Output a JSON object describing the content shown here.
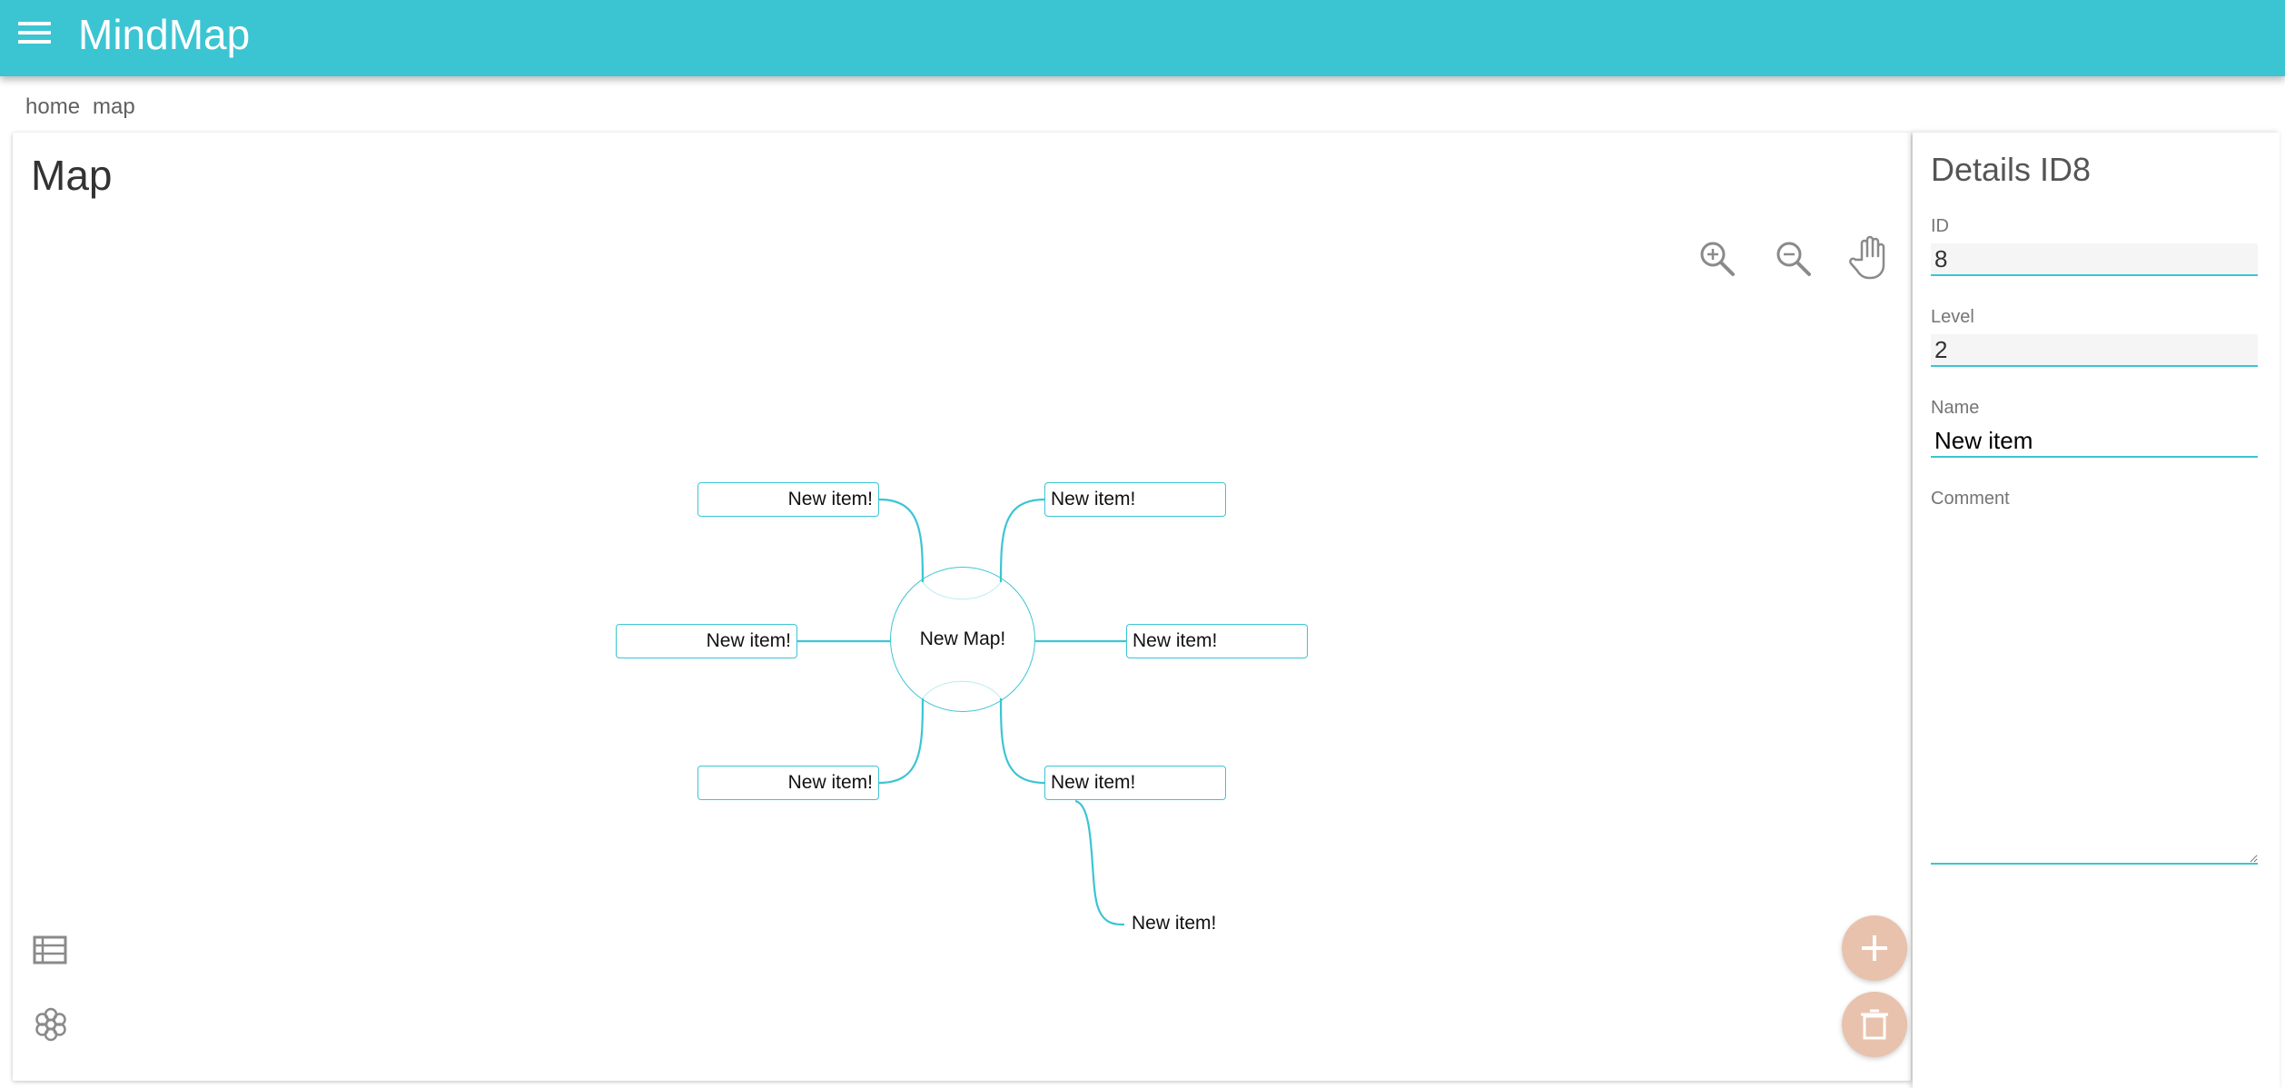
{
  "app": {
    "title": "MindMap"
  },
  "breadcrumb": [
    "home",
    "map"
  ],
  "map": {
    "title": "Map",
    "center_label": "New Map!",
    "nodes": {
      "top_left": "New item!",
      "top_right": "New item!",
      "mid_left": "New item!",
      "mid_right": "New item!",
      "bottom_left": "New item!",
      "bottom_right": "New item!",
      "child": "New item!"
    },
    "controls": [
      "zoom-in-icon",
      "zoom-out-icon",
      "pan-hand-icon"
    ]
  },
  "sidebar_icons": [
    "list-icon",
    "flower-icon"
  ],
  "fab": [
    "add-icon",
    "delete-icon"
  ],
  "details": {
    "title": "Details ID8",
    "id_label": "ID",
    "id_value": "8",
    "level_label": "Level",
    "level_value": "2",
    "name_label": "Name",
    "name_value": "New item",
    "comment_label": "Comment",
    "comment_value": ""
  },
  "colors": {
    "primary": "#3bc5d3",
    "fab": "#e8c2ac",
    "icon": "#8a8a8a"
  }
}
